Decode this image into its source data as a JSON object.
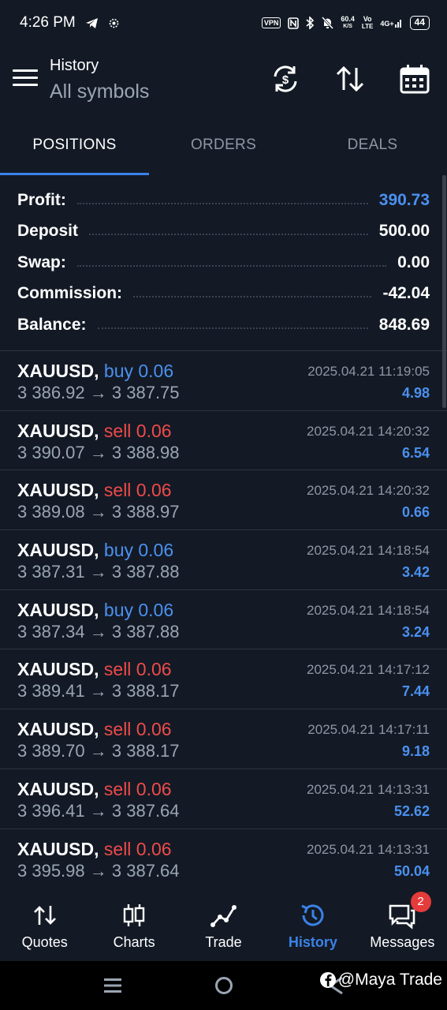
{
  "status_bar": {
    "time": "4:26 PM",
    "vpn": "VPN",
    "speed_value": "60.4",
    "speed_unit": "K/S",
    "volte_top": "Vo",
    "volte_bottom": "LTE",
    "network": "4G+",
    "battery": "44"
  },
  "header": {
    "title": "History",
    "subtitle": "All symbols"
  },
  "tabs": [
    {
      "label": "POSITIONS",
      "active": true
    },
    {
      "label": "ORDERS",
      "active": false
    },
    {
      "label": "DEALS",
      "active": false
    }
  ],
  "summary": [
    {
      "label": "Profit:",
      "value": "390.73",
      "highlight": true
    },
    {
      "label": "Deposit",
      "value": "500.00",
      "highlight": false
    },
    {
      "label": "Swap:",
      "value": "0.00",
      "highlight": false
    },
    {
      "label": "Commission:",
      "value": "-42.04",
      "highlight": false
    },
    {
      "label": "Balance:",
      "value": "848.69",
      "highlight": false
    }
  ],
  "positions": [
    {
      "symbol": "XAUUSD,",
      "type": "buy 0.06",
      "side": "buy",
      "open": "3 386.92",
      "close": "3 387.75",
      "time": "2025.04.21 11:19:05",
      "profit": "4.98"
    },
    {
      "symbol": "XAUUSD,",
      "type": "sell 0.06",
      "side": "sell",
      "open": "3 390.07",
      "close": "3 388.98",
      "time": "2025.04.21 14:20:32",
      "profit": "6.54"
    },
    {
      "symbol": "XAUUSD,",
      "type": "sell 0.06",
      "side": "sell",
      "open": "3 389.08",
      "close": "3 388.97",
      "time": "2025.04.21 14:20:32",
      "profit": "0.66"
    },
    {
      "symbol": "XAUUSD,",
      "type": "buy 0.06",
      "side": "buy",
      "open": "3 387.31",
      "close": "3 387.88",
      "time": "2025.04.21 14:18:54",
      "profit": "3.42"
    },
    {
      "symbol": "XAUUSD,",
      "type": "buy 0.06",
      "side": "buy",
      "open": "3 387.34",
      "close": "3 387.88",
      "time": "2025.04.21 14:18:54",
      "profit": "3.24"
    },
    {
      "symbol": "XAUUSD,",
      "type": "sell 0.06",
      "side": "sell",
      "open": "3 389.41",
      "close": "3 388.17",
      "time": "2025.04.21 14:17:12",
      "profit": "7.44"
    },
    {
      "symbol": "XAUUSD,",
      "type": "sell 0.06",
      "side": "sell",
      "open": "3 389.70",
      "close": "3 388.17",
      "time": "2025.04.21 14:17:11",
      "profit": "9.18"
    },
    {
      "symbol": "XAUUSD,",
      "type": "sell 0.06",
      "side": "sell",
      "open": "3 396.41",
      "close": "3 387.64",
      "time": "2025.04.21 14:13:31",
      "profit": "52.62"
    },
    {
      "symbol": "XAUUSD,",
      "type": "sell 0.06",
      "side": "sell",
      "open": "3 395.98",
      "close": "3 387.64",
      "time": "2025.04.21 14:13:31",
      "profit": "50.04"
    }
  ],
  "arrow": "→",
  "bottom_nav": [
    {
      "label": "Quotes",
      "icon": "quotes-icon",
      "active": false
    },
    {
      "label": "Charts",
      "icon": "charts-icon",
      "active": false
    },
    {
      "label": "Trade",
      "icon": "trade-icon",
      "active": false
    },
    {
      "label": "History",
      "icon": "history-icon",
      "active": true
    },
    {
      "label": "Messages",
      "icon": "messages-icon",
      "active": false,
      "badge": "2"
    }
  ],
  "watermark": "@Maya Trade",
  "colors": {
    "background": "#131a25",
    "accent_blue": "#3b82e8",
    "profit_blue": "#4b90f0",
    "sell_red": "#ef4a4a",
    "muted": "#9aa5b3"
  }
}
